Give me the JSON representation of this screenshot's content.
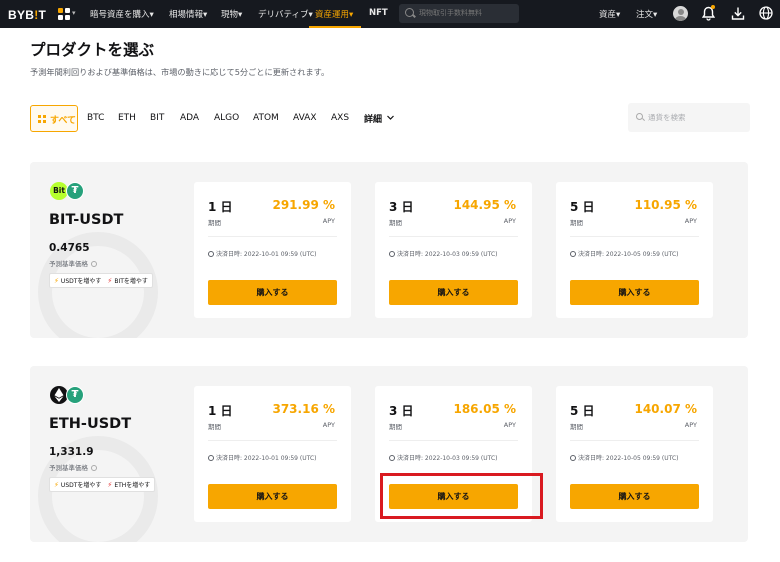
{
  "nav": {
    "logo_main": "BYB",
    "logo_excl": "!",
    "logo_tail": "T",
    "items": [
      "暗号資産を購入▾",
      "相場情報▾",
      "現物▾",
      "デリバティブ▾",
      "資産運用▾",
      "NFT"
    ],
    "search_placeholder": "現物取引手数料無料",
    "assets_label": "資産▾",
    "orders_label": "注文▾"
  },
  "page": {
    "title": "プロダクトを選ぶ",
    "subtitle": "予測年間利回りおよび基準価格は、市場の動きに応じて5分ごとに更新されます。"
  },
  "filters": {
    "all_label": "すべて",
    "coins": [
      "BTC",
      "ETH",
      "BIT",
      "ADA",
      "ALGO",
      "ATOM",
      "AVAX",
      "AXS"
    ],
    "more_label": "詳細",
    "search_placeholder": "通貨を検索"
  },
  "products": [
    {
      "coin_badge": "Bit",
      "tether_symbol": "₮",
      "pair": "BIT-USDT",
      "price": "0.4765",
      "price_label": "予測基準価格",
      "pill_usdt": "USDTを増やす",
      "pill_coin": "BITを増やす",
      "terms": [
        {
          "days": "1 日",
          "period_label": "期間",
          "rate": "291.99 %",
          "apy_label": "APY",
          "settlement": "決済日時: 2022-10-01 09:59 (UTC)",
          "button": "購入する"
        },
        {
          "days": "3 日",
          "period_label": "期間",
          "rate": "144.95 %",
          "apy_label": "APY",
          "settlement": "決済日時: 2022-10-03 09:59 (UTC)",
          "button": "購入する"
        },
        {
          "days": "5 日",
          "period_label": "期間",
          "rate": "110.95 %",
          "apy_label": "APY",
          "settlement": "決済日時: 2022-10-05 09:59 (UTC)",
          "button": "購入する"
        }
      ]
    },
    {
      "coin_badge": "",
      "tether_symbol": "₮",
      "pair": "ETH-USDT",
      "price": "1,331.9",
      "price_label": "予測基準価格",
      "pill_usdt": "USDTを増やす",
      "pill_coin": "ETHを増やす",
      "terms": [
        {
          "days": "1 日",
          "period_label": "期間",
          "rate": "373.16 %",
          "apy_label": "APY",
          "settlement": "決済日時: 2022-10-01 09:59 (UTC)",
          "button": "購入する"
        },
        {
          "days": "3 日",
          "period_label": "期間",
          "rate": "186.05 %",
          "apy_label": "APY",
          "settlement": "決済日時: 2022-10-03 09:59 (UTC)",
          "button": "購入する"
        },
        {
          "days": "5 日",
          "period_label": "期間",
          "rate": "140.07 %",
          "apy_label": "APY",
          "settlement": "決済日時: 2022-10-05 09:59 (UTC)",
          "button": "購入する"
        }
      ]
    }
  ],
  "colors": {
    "accent": "#f7a600",
    "nav_bg": "#16191f",
    "highlight": "#d91a20",
    "tether": "#26a17b",
    "bit": "#b6ff2f"
  },
  "icons": [
    "grid-menu-icon",
    "search-icon",
    "user-avatar-icon",
    "bell-icon",
    "download-icon",
    "globe-icon",
    "chevron-down-icon",
    "clock-icon",
    "info-icon",
    "bolt-icon",
    "ethereum-icon",
    "tether-icon"
  ]
}
